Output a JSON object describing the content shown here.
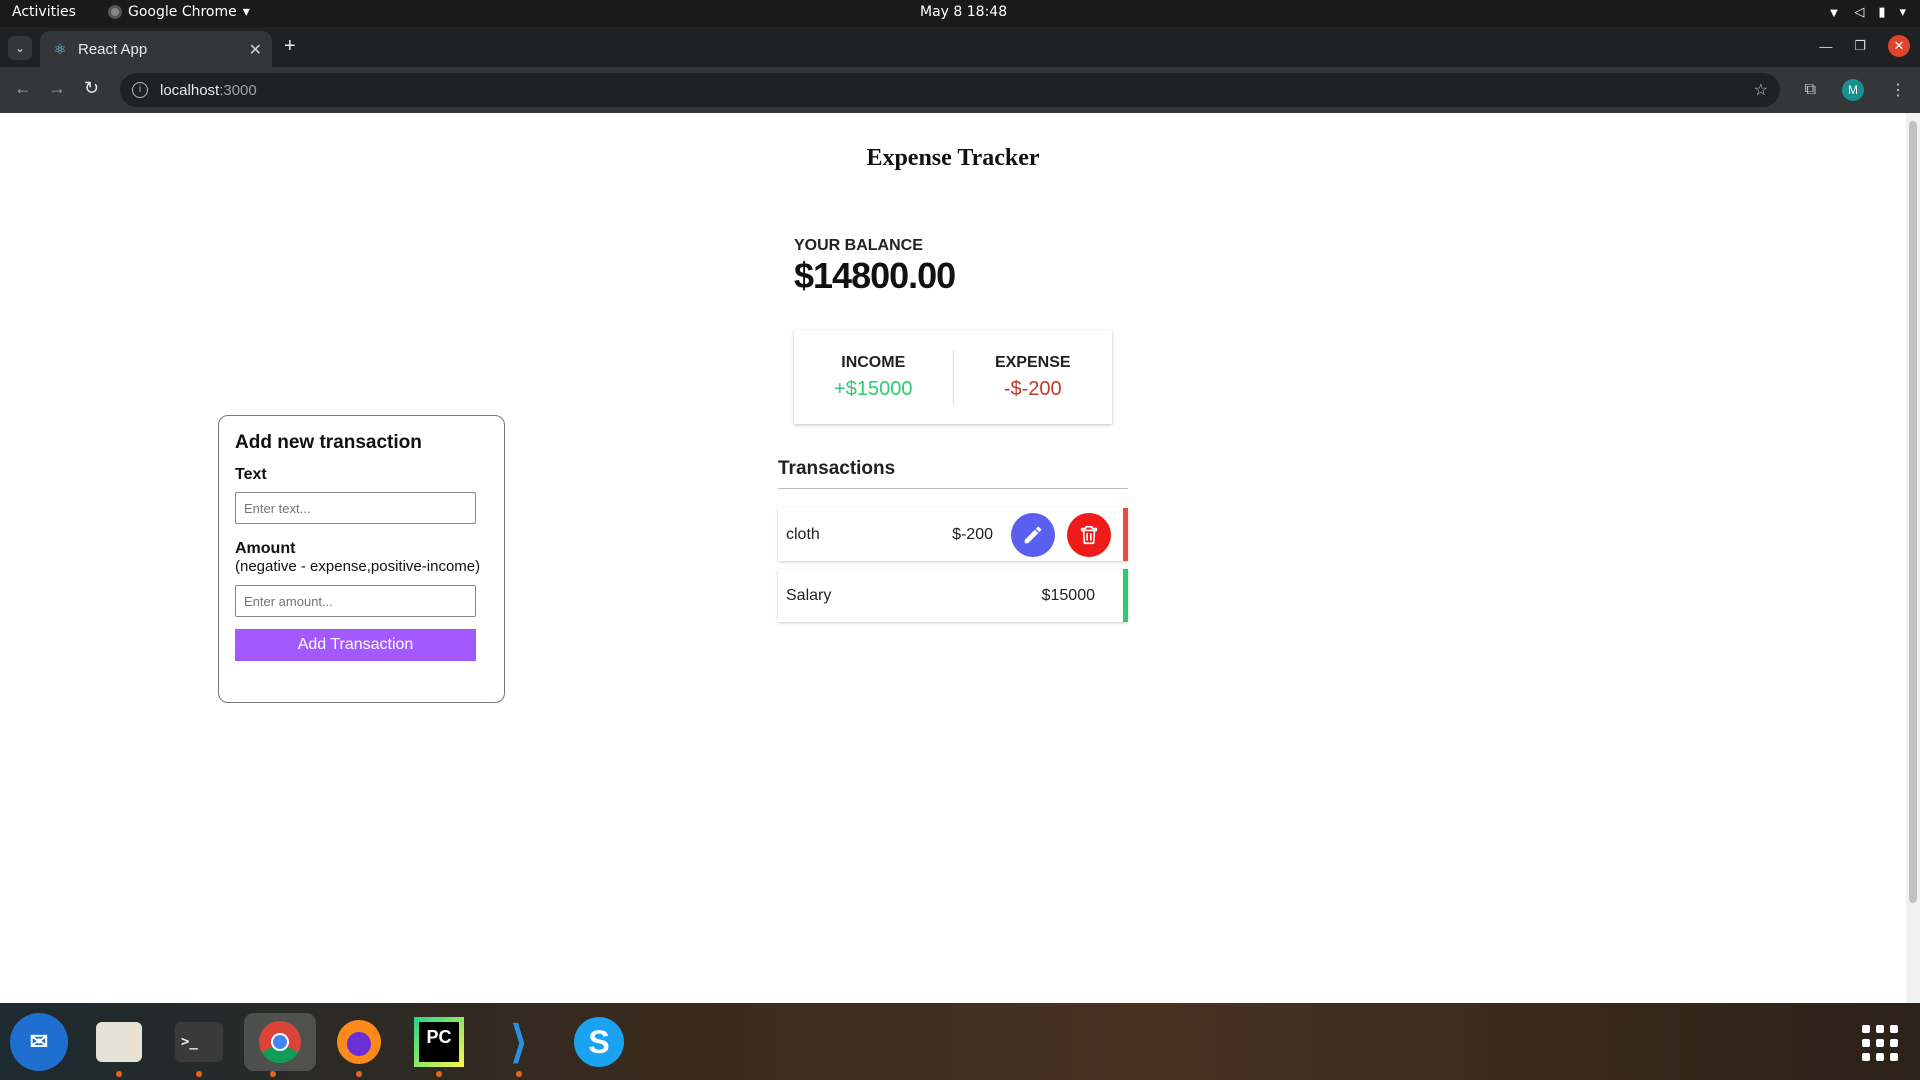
{
  "system_bar": {
    "activities": "Activities",
    "app_name": "Google Chrome",
    "clock": "May 8  18:48"
  },
  "browser": {
    "tab_title": "React App",
    "url_host": "localhost",
    "url_port": ":3000",
    "profile_initial": "M"
  },
  "app": {
    "title": "Expense Tracker",
    "balance_label": "YOUR BALANCE",
    "balance_amount": "$14800.00",
    "income_label": "INCOME",
    "income_amount": "+$15000",
    "expense_label": "EXPENSE",
    "expense_amount": "-$-200",
    "transactions_heading": "Transactions",
    "transactions": [
      {
        "text": "cloth",
        "amount": "$-200",
        "type": "expense"
      },
      {
        "text": "Salary",
        "amount": "$15000",
        "type": "income"
      }
    ]
  },
  "form": {
    "title": "Add new transaction",
    "text_label": "Text",
    "text_placeholder": "Enter text...",
    "amount_label": "Amount",
    "amount_hint": "(negative - expense,positive-income)",
    "amount_placeholder": "Enter amount...",
    "submit_label": "Add Transaction"
  },
  "colors": {
    "income": "#2ecc71",
    "expense": "#c0392b",
    "edit_button": "#5b5ff0",
    "delete_button": "#ef1b1b",
    "submit_button": "#a259ff"
  },
  "dock": {
    "apps": [
      "thunderbird-icon",
      "files-icon",
      "terminal-icon",
      "chrome-icon",
      "firefox-icon",
      "pycharm-icon",
      "vscode-icon",
      "skype-icon"
    ]
  }
}
